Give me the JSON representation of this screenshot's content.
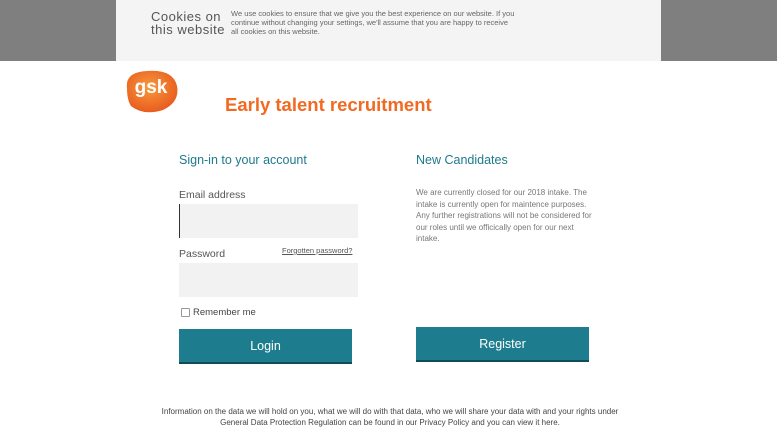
{
  "cookie": {
    "title_line1": "Cookies on",
    "title_line2": "this website",
    "text": "We use cookies to ensure that we give you the best experience on our website. If you continue without changing your settings, we'll assume that you are happy to receive all cookies on this website."
  },
  "logo": {
    "text": "gsk"
  },
  "page_title": "Early talent recruitment",
  "signin": {
    "heading": "Sign-in to your account",
    "email_label": "Email address",
    "email_value": "",
    "password_label": "Password",
    "forgot_link": "Forgotten password?",
    "password_value": "",
    "remember_label": "Remember me",
    "login_button": "Login"
  },
  "new_candidates": {
    "heading": "New Candidates",
    "text": "We are currently closed for our 2018 intake. The intake is currently open for maintence purposes. Any further registrations will not be considered for our roles until we officically open for our next intake.",
    "register_button": "Register"
  },
  "footer": {
    "line1": "Information on the data we will hold on you, what we will do with that data, who we will share your data with and your rights under",
    "line2": "General Data Protection Regulation can be found in our Privacy Policy and you can view it here."
  },
  "colors": {
    "accent_orange": "#f26a22",
    "teal": "#1d7d8e",
    "cookie_bg": "#7f7f7f"
  }
}
